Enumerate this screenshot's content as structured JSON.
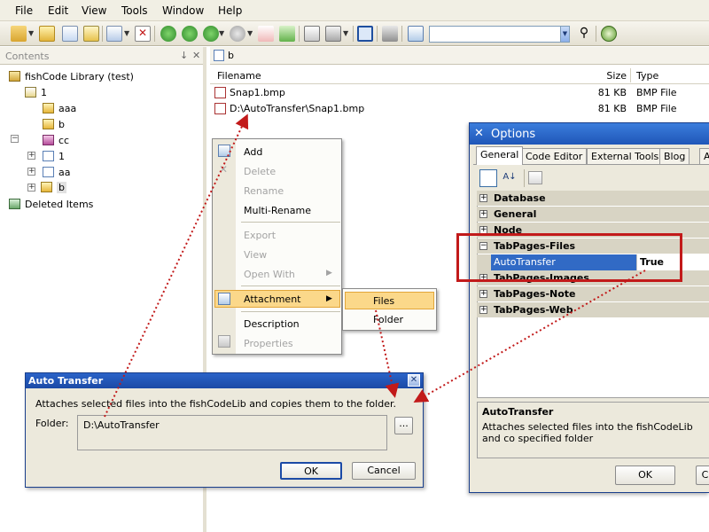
{
  "menubar": {
    "items": [
      "File",
      "Edit",
      "View",
      "Tools",
      "Window",
      "Help"
    ]
  },
  "toolbar": {
    "search_value": ""
  },
  "left_panel": {
    "title": "Contents",
    "pin_glyph": "↓",
    "close_glyph": "✕",
    "tree": {
      "root": "fishCode Library (test)",
      "node_1": "1",
      "children": [
        "aaa",
        "b",
        "cc",
        "1",
        "aa",
        "b"
      ],
      "deleted": "Deleted Items"
    }
  },
  "address": {
    "value": "b"
  },
  "file_list": {
    "columns": [
      "Filename",
      "Size",
      "Type"
    ],
    "rows": [
      {
        "name": "Snap1.bmp",
        "size": "81 KB",
        "type": "BMP File"
      },
      {
        "name": "D:\\AutoTransfer\\Snap1.bmp",
        "size": "81 KB",
        "type": "BMP File"
      }
    ]
  },
  "context_menu": {
    "add": "Add",
    "delete": "Delete",
    "rename": "Rename",
    "multi_rename": "Multi-Rename",
    "export": "Export",
    "view": "View",
    "open_with": "Open With",
    "attachment": "Attachment",
    "description": "Description",
    "properties": "Properties"
  },
  "submenu": {
    "files": "Files",
    "folder": "Folder"
  },
  "auto_transfer_dialog": {
    "title": "Auto Transfer",
    "close_glyph": "✕",
    "message": "Attaches selected files into the fishCodeLib and copies them to the folder.",
    "folder_label": "Folder:",
    "folder_value": "D:\\AutoTransfer",
    "browse_label": "...",
    "ok_label": "OK",
    "cancel_label": "Cancel"
  },
  "options_window": {
    "title": "Options",
    "tabs": [
      "General",
      "Code Editor",
      "External Tools",
      "Blog",
      "A"
    ],
    "categories": [
      "Database",
      "General",
      "Node",
      "TabPages-Files",
      "TabPages-Images",
      "TabPages-Note",
      "TabPages-Web"
    ],
    "property_name": "AutoTransfer",
    "property_value": "True",
    "desc_title": "AutoTransfer",
    "desc_text": "Attaches selected files into the fishCodeLib and co specified folder",
    "ok_label": "OK",
    "cancel_label": "C"
  },
  "colors": {
    "menu_bg": "#f1efe4",
    "title_blue": "#1b4aa6",
    "selection_blue": "#316ac5",
    "highlight_orange": "#fbd88a",
    "annotation_red": "#c21a1a"
  }
}
